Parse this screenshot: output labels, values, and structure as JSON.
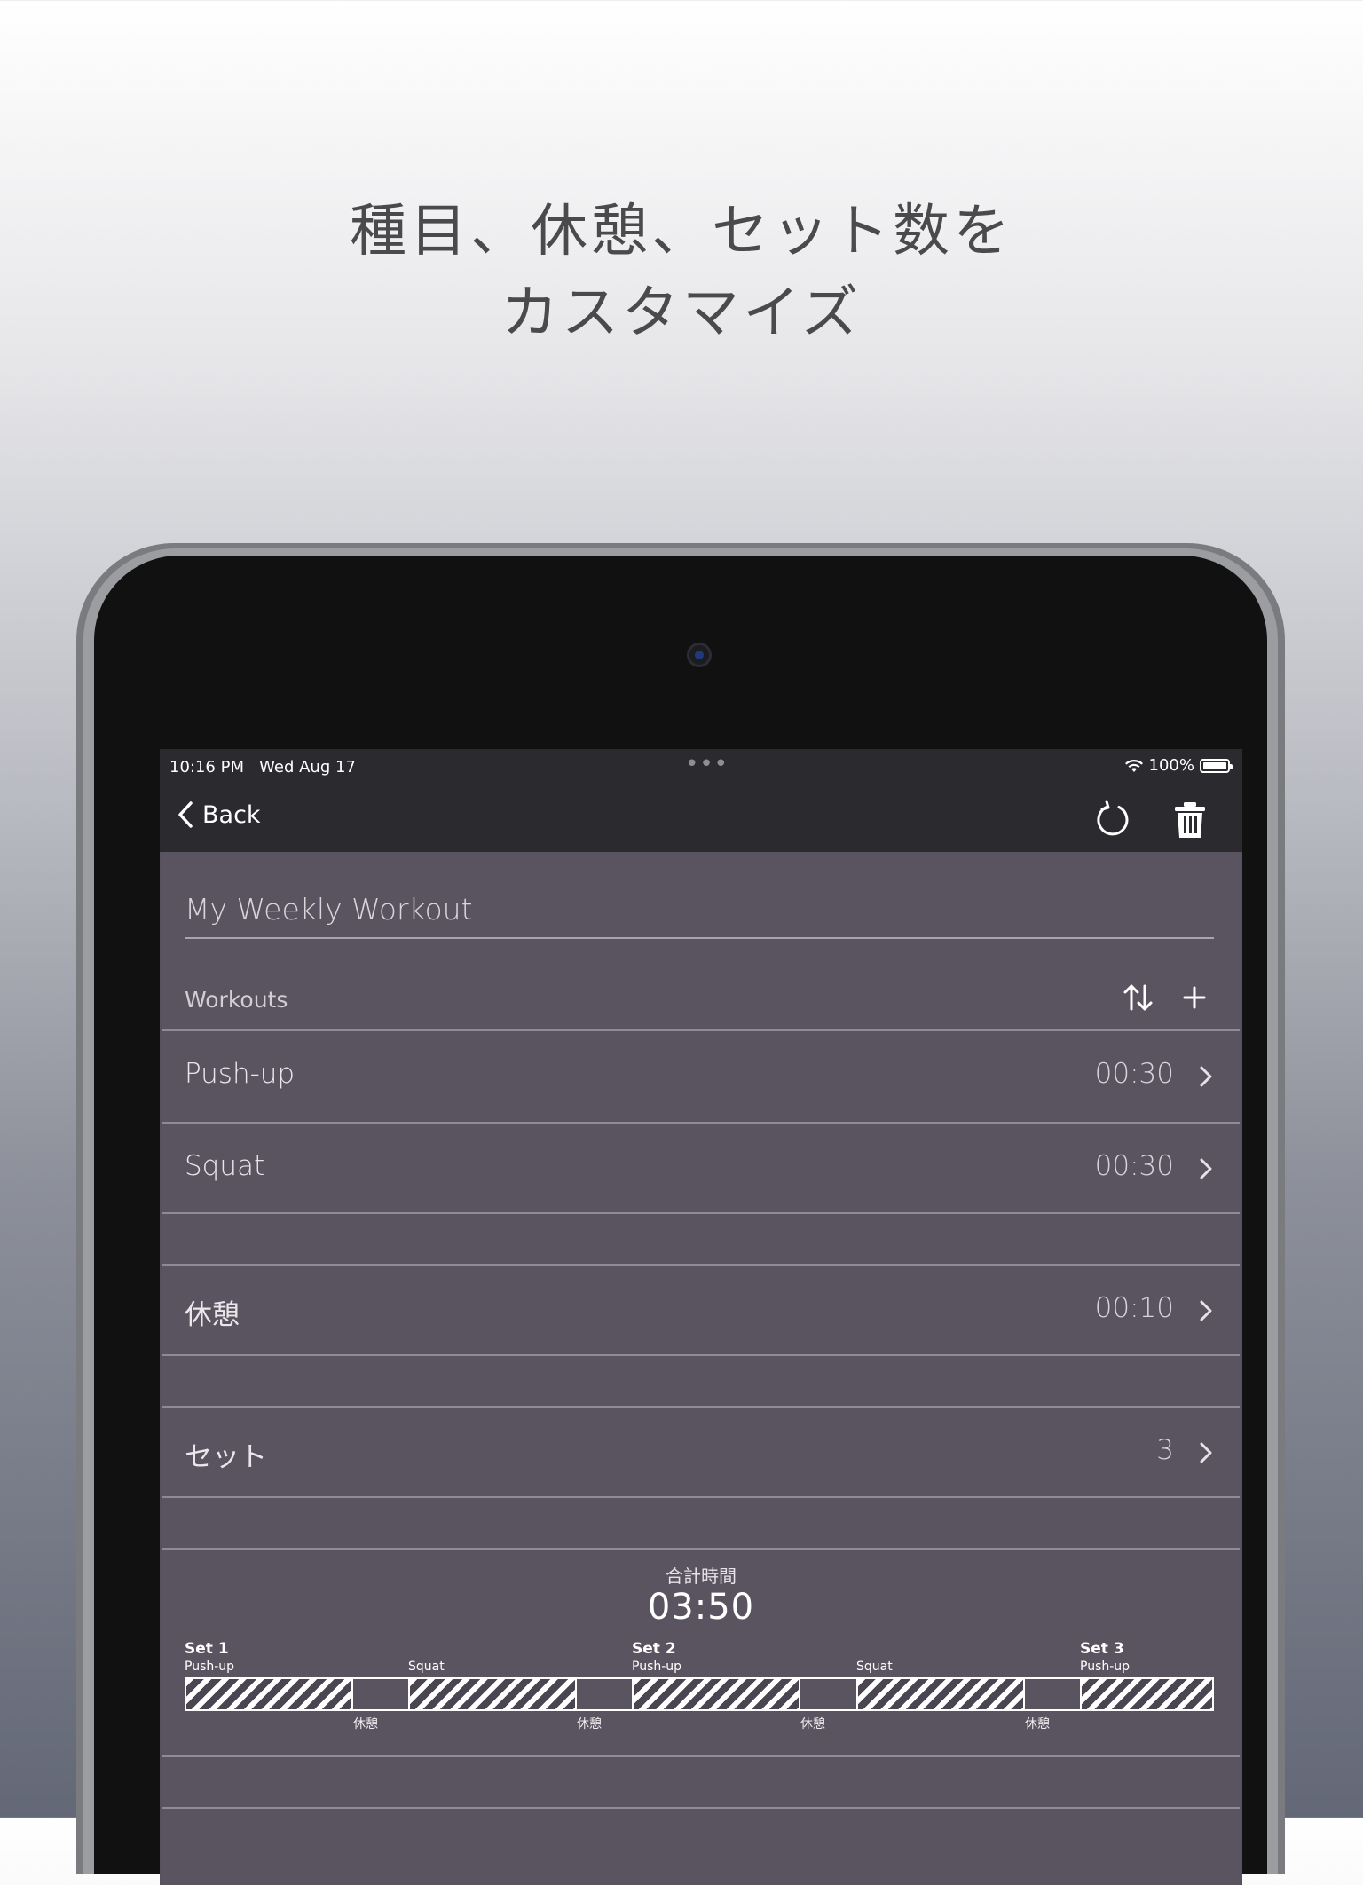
{
  "headline": {
    "line1": "種目、休憩、セット数を",
    "line2": "カスタマイズ"
  },
  "status_bar": {
    "time": "10:16 PM",
    "date": "Wed Aug 17",
    "battery": "100%"
  },
  "nav": {
    "back_label": "Back",
    "icons": [
      "reset-icon",
      "trash-icon"
    ]
  },
  "routine": {
    "title": "My Weekly Workout"
  },
  "workouts_section": {
    "header": "Workouts",
    "icons": [
      "sort-icon",
      "plus-icon"
    ],
    "items": [
      {
        "label": "Push-up",
        "value": "00:30"
      },
      {
        "label": "Squat",
        "value": "00:30"
      }
    ]
  },
  "rest": {
    "label": "休憩",
    "value": "00:10"
  },
  "sets": {
    "label": "セット",
    "value": "3"
  },
  "summary": {
    "total_label": "合計時間",
    "total_time": "03:50",
    "timeline": {
      "sets": [
        "Set 1",
        "Set 2",
        "Set 3"
      ],
      "exercises": [
        "Push-up",
        "Squat",
        "Push-up",
        "Squat",
        "Push-up"
      ],
      "rests": [
        "休憩",
        "休憩",
        "休憩",
        "休憩"
      ]
    }
  },
  "colors": {
    "screen_bg": "#5a5461",
    "bar_bg": "#2b2a2f",
    "text": "#ececf0",
    "divider": "#8f8a95"
  }
}
